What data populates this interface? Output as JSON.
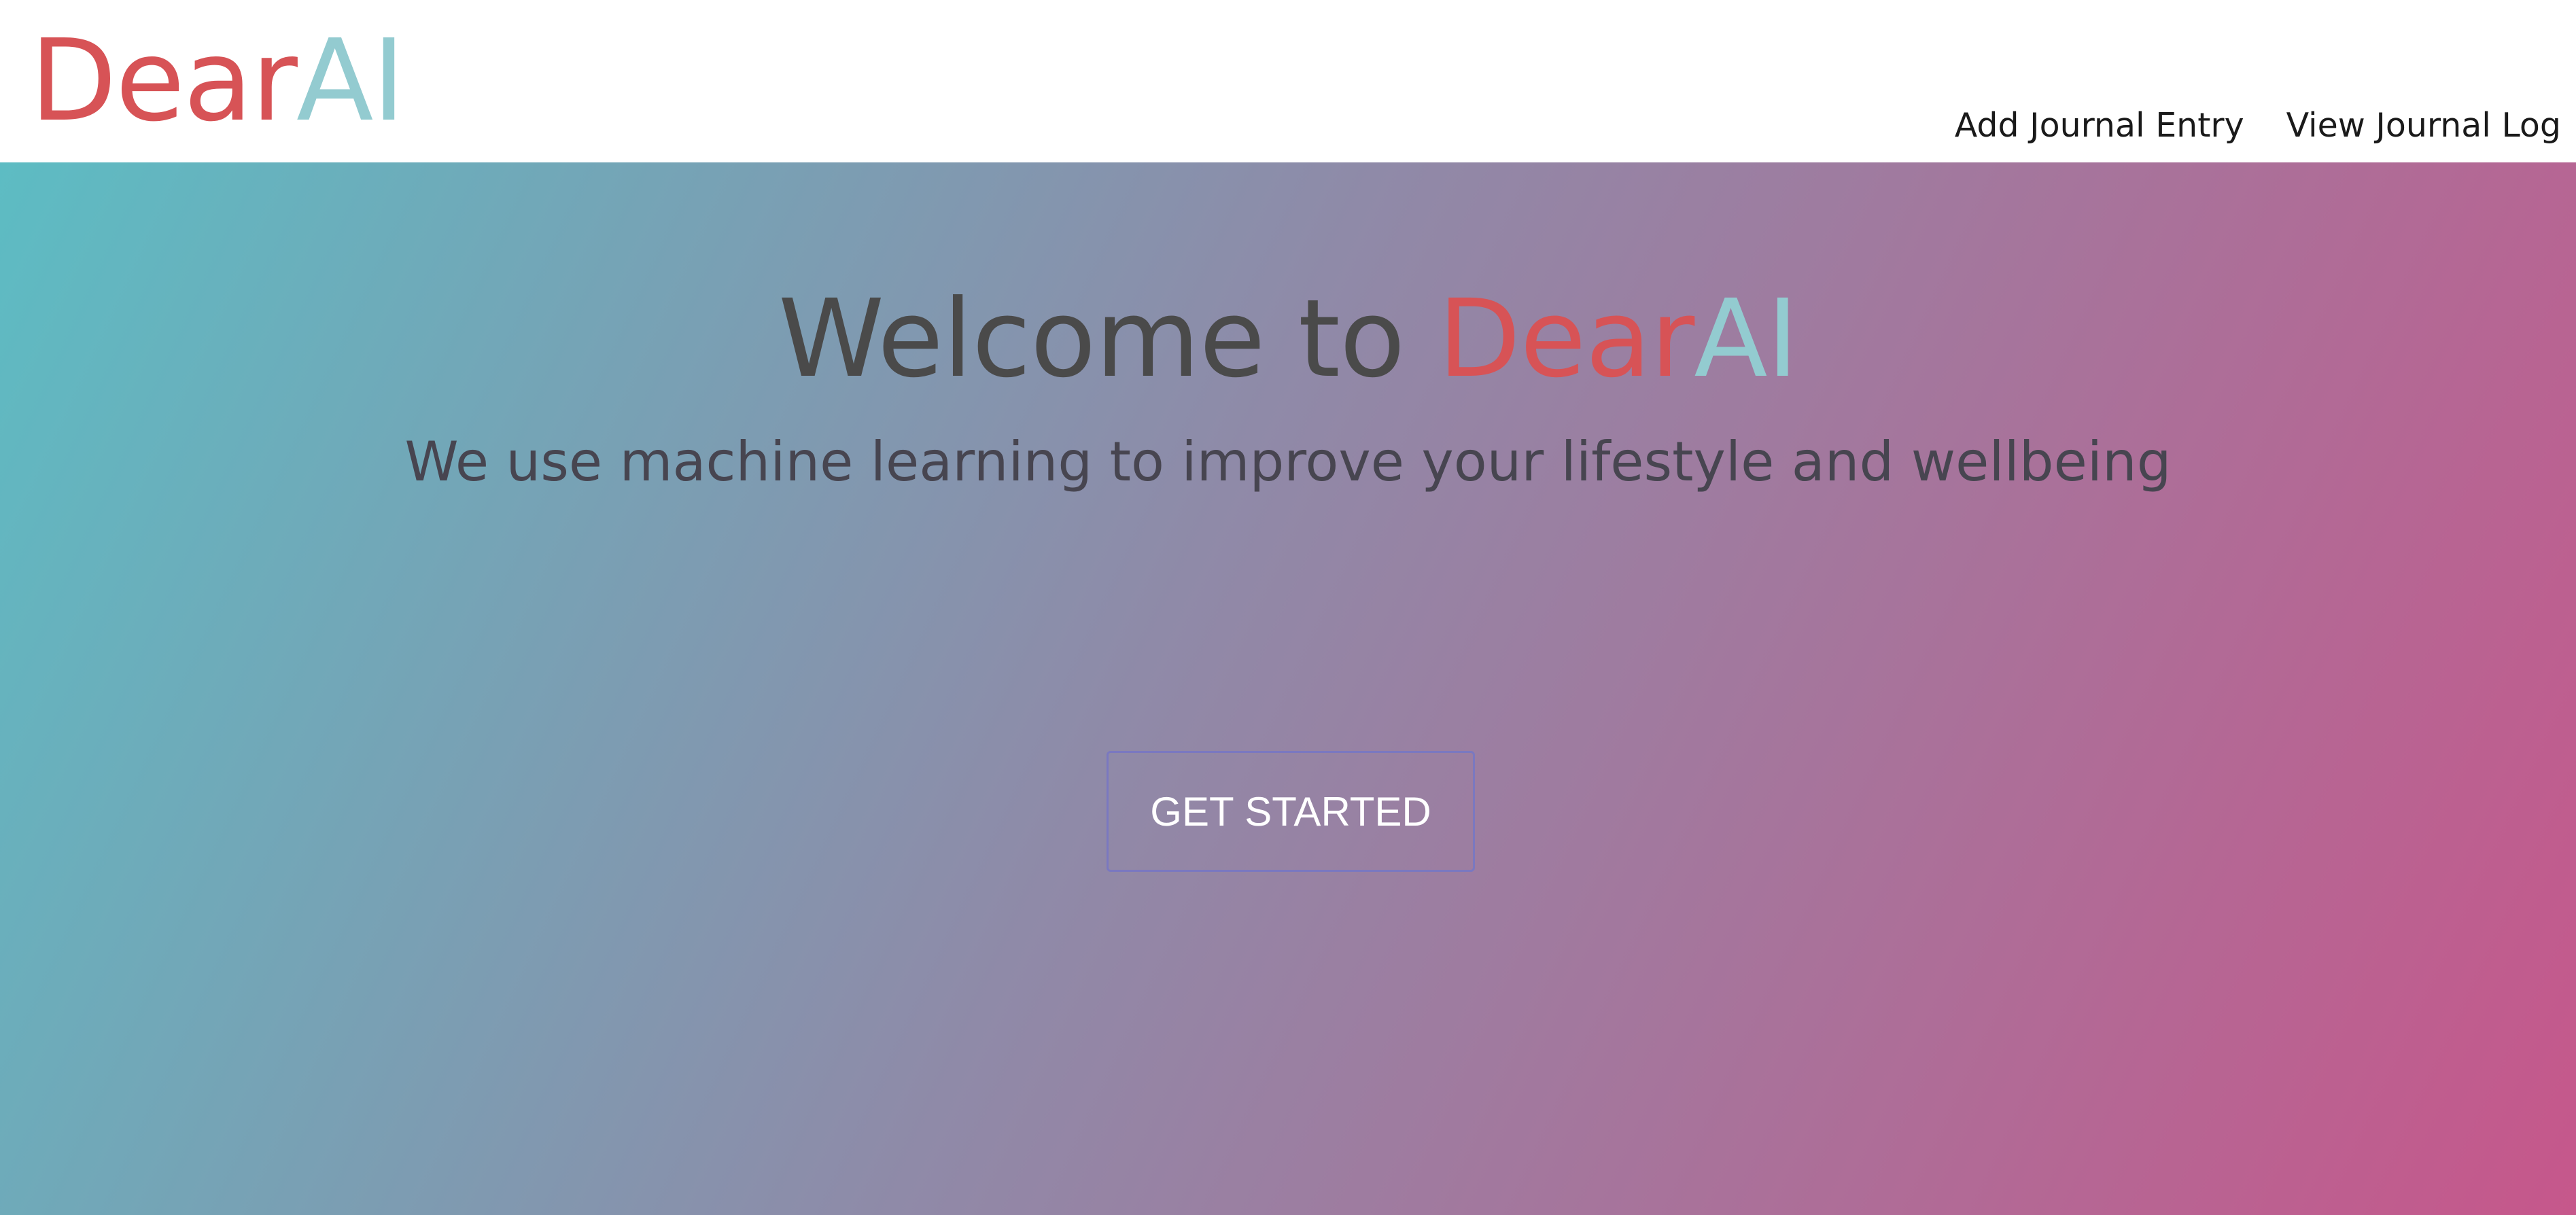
{
  "header": {
    "logo": {
      "part1": "Dear",
      "part2": "AI"
    },
    "nav": [
      {
        "label": "Add Journal Entry"
      },
      {
        "label": "View Journal Log"
      }
    ]
  },
  "hero": {
    "title_prefix": "Welcome to ",
    "title_brand_part1": "Dear",
    "title_brand_part2": "AI",
    "subtitle": "We use machine learning to improve your lifestyle and wellbeing",
    "cta_label": "GET STARTED"
  },
  "colors": {
    "brand_red": "#d75356",
    "brand_teal": "#93cbd0",
    "gradient_start": "#5dbcc3",
    "gradient_mid": "#8f8aa8",
    "gradient_end": "#c6578b",
    "button_border": "#7a78c0"
  }
}
